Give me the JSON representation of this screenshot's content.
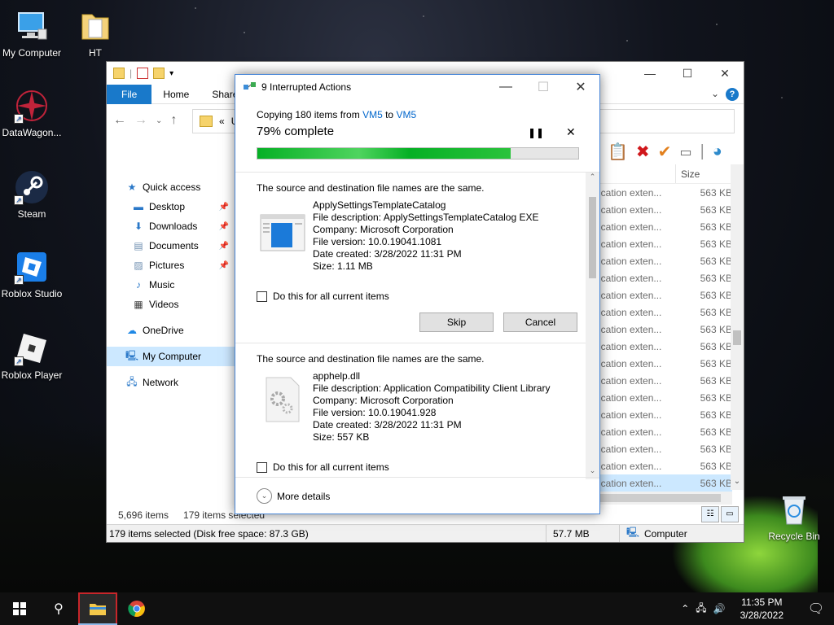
{
  "desktop": {
    "icons": [
      {
        "label": "My Computer"
      },
      {
        "label": "HT"
      },
      {
        "label": "DataWagon..."
      },
      {
        "label": "Steam"
      },
      {
        "label": "Roblox Studio"
      },
      {
        "label": "Roblox Player"
      },
      {
        "label": "Recycle Bin"
      }
    ]
  },
  "explorer": {
    "ribbon_tabs": {
      "file": "File",
      "home": "Home",
      "share": "Share"
    },
    "address_prefix": "«",
    "address_text": "Us",
    "nav": {
      "quick_access": "Quick access",
      "desktop": "Desktop",
      "downloads": "Downloads",
      "documents": "Documents",
      "pictures": "Pictures",
      "music": "Music",
      "videos": "Videos",
      "onedrive": "OneDrive",
      "my_computer": "My Computer",
      "network": "Network"
    },
    "size_header": "Size",
    "rows": [
      {
        "type": "ication exten...",
        "size": "563 KB"
      },
      {
        "type": "ication exten...",
        "size": "563 KB"
      },
      {
        "type": "ication exten...",
        "size": "563 KB"
      },
      {
        "type": "ication exten...",
        "size": "563 KB"
      },
      {
        "type": "ication exten...",
        "size": "563 KB"
      },
      {
        "type": "ication exten...",
        "size": "563 KB"
      },
      {
        "type": "ication exten...",
        "size": "563 KB"
      },
      {
        "type": "ication exten...",
        "size": "563 KB"
      },
      {
        "type": "ication exten...",
        "size": "563 KB"
      },
      {
        "type": "ication exten...",
        "size": "563 KB"
      },
      {
        "type": "ication exten...",
        "size": "563 KB"
      },
      {
        "type": "ication exten...",
        "size": "563 KB"
      },
      {
        "type": "ication exten...",
        "size": "563 KB"
      },
      {
        "type": "ication exten...",
        "size": "563 KB"
      },
      {
        "type": "ication exten...",
        "size": "563 KB"
      },
      {
        "type": "ication exten...",
        "size": "563 KB"
      },
      {
        "type": "ication exten...",
        "size": "563 KB"
      },
      {
        "type": "ication exten...",
        "size": "563 KB"
      }
    ],
    "item_count": "5,696 items",
    "selected_count": "179 items selected",
    "status": {
      "selection": "179 items selected (Disk free space: 87.3 GB)",
      "size": "57.7 MB",
      "location": "Computer"
    }
  },
  "dialog": {
    "title": "9 Interrupted Actions",
    "copy_prefix": "Copying 180 items from ",
    "source": "VM5",
    "copy_mid": " to ",
    "dest": "VM5",
    "percent_text": "79% complete",
    "progress": 0.79,
    "progress_color": "#06b025",
    "conflicts": [
      {
        "heading": "The source and destination file names are the same.",
        "name": "ApplySettingsTemplateCatalog",
        "description": "File description: ApplySettingsTemplateCatalog EXE",
        "company": "Company: Microsoft Corporation",
        "version": "File version: 10.0.19041.1081",
        "created": "Date created: 3/28/2022 11:31 PM",
        "size": "Size: 1.11 MB",
        "checkbox": "Do this for all current items",
        "skip": "Skip",
        "cancel": "Cancel"
      },
      {
        "heading": "The source and destination file names are the same.",
        "name": "apphelp.dll",
        "description": "File description: Application Compatibility Client Library",
        "company": "Company: Microsoft Corporation",
        "version": "File version: 10.0.19041.928",
        "created": "Date created: 3/28/2022 11:31 PM",
        "size": "Size: 557 KB",
        "checkbox": "Do this for all current items"
      }
    ],
    "more_details": "More details"
  },
  "taskbar": {
    "time": "11:35 PM",
    "date": "3/28/2022",
    "accent": "#8bb8e8"
  }
}
